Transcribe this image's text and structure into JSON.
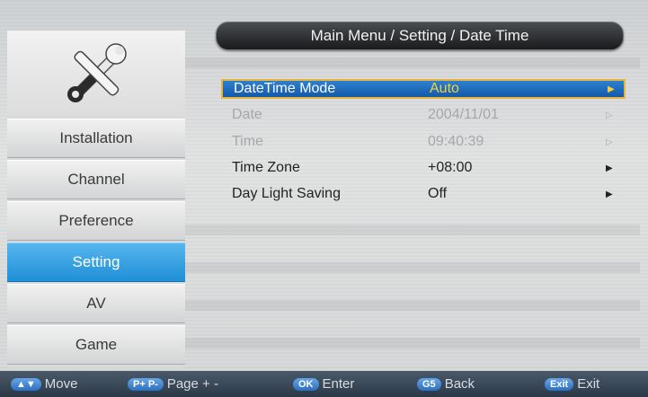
{
  "header": {
    "breadcrumb": "Main Menu / Setting / Date Time"
  },
  "sidebar": {
    "logo_icon": "tools-icon",
    "items": [
      {
        "label": "Installation",
        "active": false
      },
      {
        "label": "Channel",
        "active": false
      },
      {
        "label": "Preference",
        "active": false
      },
      {
        "label": "Setting",
        "active": true
      },
      {
        "label": "AV",
        "active": false
      },
      {
        "label": "Game",
        "active": false
      }
    ]
  },
  "settings": [
    {
      "label": "DateTime Mode",
      "value": "Auto",
      "state": "selected"
    },
    {
      "label": "Date",
      "value": "2004/11/01",
      "state": "disabled"
    },
    {
      "label": "Time",
      "value": "09:40:39",
      "state": "disabled"
    },
    {
      "label": "Time Zone",
      "value": "+08:00",
      "state": "normal"
    },
    {
      "label": "Day Light Saving",
      "value": "Off",
      "state": "normal"
    }
  ],
  "footer": {
    "move": {
      "key": "▲▼",
      "label": "Move"
    },
    "page": {
      "key": "P+ P-",
      "label": "Page + -"
    },
    "enter": {
      "key": "OK",
      "label": "Enter"
    },
    "back": {
      "key": "G5",
      "label": "Back"
    },
    "exit": {
      "key": "Exit",
      "label": "Exit"
    }
  },
  "colors": {
    "accent": "#1f8fd6",
    "selection": "#125aa8",
    "highlight": "#e6b43c"
  }
}
